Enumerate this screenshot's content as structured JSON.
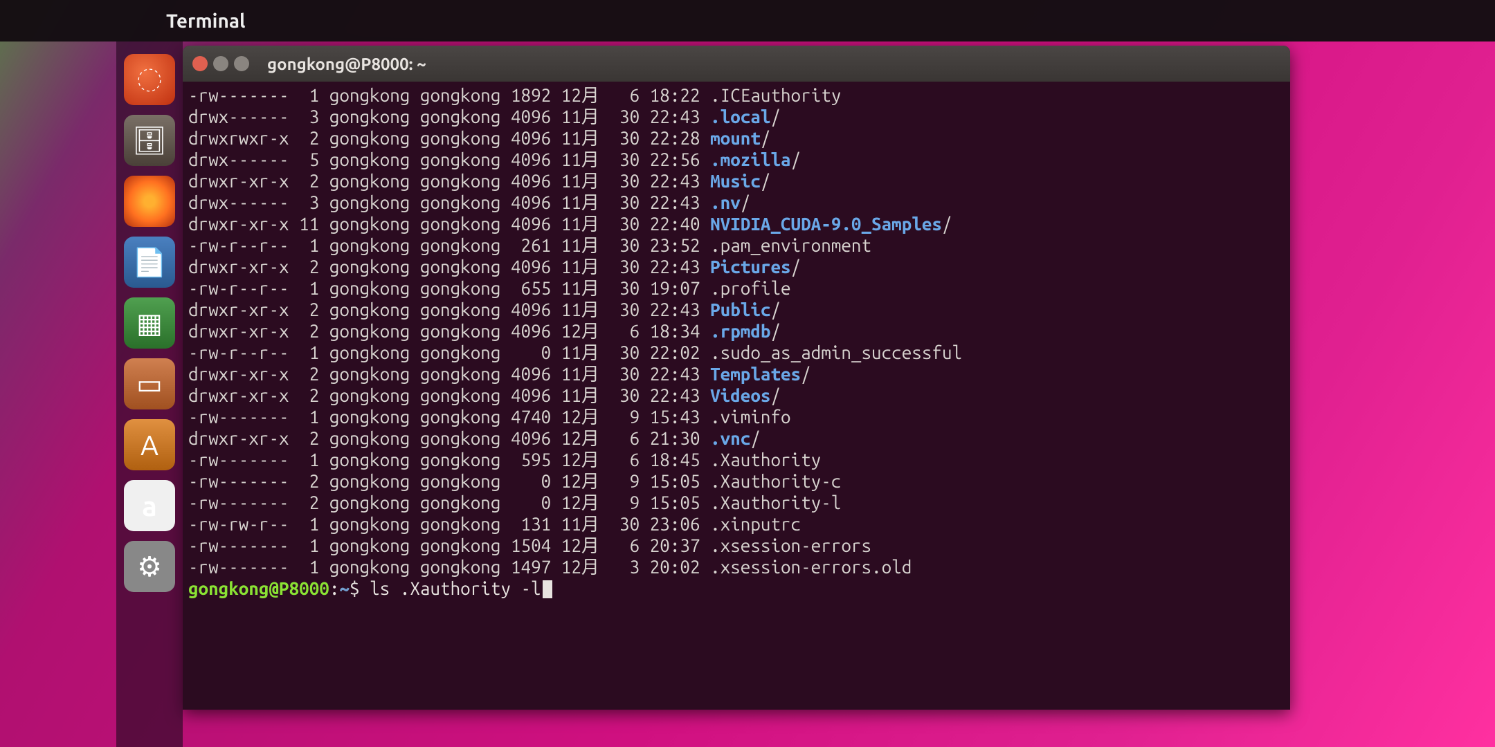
{
  "top_bar": {
    "title": "Terminal"
  },
  "dock": {
    "items": [
      {
        "name": "ubuntu",
        "glyph": "◌"
      },
      {
        "name": "files",
        "glyph": "🗄"
      },
      {
        "name": "firefox",
        "glyph": ""
      },
      {
        "name": "writer",
        "glyph": "📄"
      },
      {
        "name": "calc",
        "glyph": "▦"
      },
      {
        "name": "impress",
        "glyph": "▭"
      },
      {
        "name": "software",
        "glyph": "A"
      },
      {
        "name": "amazon",
        "glyph": "a"
      },
      {
        "name": "settings",
        "glyph": "⚙"
      }
    ]
  },
  "terminal": {
    "title": "gongkong@P8000: ~",
    "prompt": {
      "user_host": "gongkong@P8000",
      "path": "~",
      "command": "ls .Xauthority -l"
    },
    "listing": [
      {
        "perm": "-rw-------",
        "links": "1",
        "owner": "gongkong",
        "group": "gongkong",
        "size": "1892",
        "month": "12月",
        "day": "6",
        "time": "18:22",
        "name": ".ICEauthority",
        "is_dir": false
      },
      {
        "perm": "drwx------",
        "links": "3",
        "owner": "gongkong",
        "group": "gongkong",
        "size": "4096",
        "month": "11月",
        "day": "30",
        "time": "22:43",
        "name": ".local",
        "is_dir": true
      },
      {
        "perm": "drwxrwxr-x",
        "links": "2",
        "owner": "gongkong",
        "group": "gongkong",
        "size": "4096",
        "month": "11月",
        "day": "30",
        "time": "22:28",
        "name": "mount",
        "is_dir": true
      },
      {
        "perm": "drwx------",
        "links": "5",
        "owner": "gongkong",
        "group": "gongkong",
        "size": "4096",
        "month": "11月",
        "day": "30",
        "time": "22:56",
        "name": ".mozilla",
        "is_dir": true
      },
      {
        "perm": "drwxr-xr-x",
        "links": "2",
        "owner": "gongkong",
        "group": "gongkong",
        "size": "4096",
        "month": "11月",
        "day": "30",
        "time": "22:43",
        "name": "Music",
        "is_dir": true
      },
      {
        "perm": "drwx------",
        "links": "3",
        "owner": "gongkong",
        "group": "gongkong",
        "size": "4096",
        "month": "11月",
        "day": "30",
        "time": "22:43",
        "name": ".nv",
        "is_dir": true
      },
      {
        "perm": "drwxr-xr-x",
        "links": "11",
        "owner": "gongkong",
        "group": "gongkong",
        "size": "4096",
        "month": "11月",
        "day": "30",
        "time": "22:40",
        "name": "NVIDIA_CUDA-9.0_Samples",
        "is_dir": true
      },
      {
        "perm": "-rw-r--r--",
        "links": "1",
        "owner": "gongkong",
        "group": "gongkong",
        "size": "261",
        "month": "11月",
        "day": "30",
        "time": "23:52",
        "name": ".pam_environment",
        "is_dir": false
      },
      {
        "perm": "drwxr-xr-x",
        "links": "2",
        "owner": "gongkong",
        "group": "gongkong",
        "size": "4096",
        "month": "11月",
        "day": "30",
        "time": "22:43",
        "name": "Pictures",
        "is_dir": true
      },
      {
        "perm": "-rw-r--r--",
        "links": "1",
        "owner": "gongkong",
        "group": "gongkong",
        "size": "655",
        "month": "11月",
        "day": "30",
        "time": "19:07",
        "name": ".profile",
        "is_dir": false
      },
      {
        "perm": "drwxr-xr-x",
        "links": "2",
        "owner": "gongkong",
        "group": "gongkong",
        "size": "4096",
        "month": "11月",
        "day": "30",
        "time": "22:43",
        "name": "Public",
        "is_dir": true
      },
      {
        "perm": "drwxr-xr-x",
        "links": "2",
        "owner": "gongkong",
        "group": "gongkong",
        "size": "4096",
        "month": "12月",
        "day": "6",
        "time": "18:34",
        "name": ".rpmdb",
        "is_dir": true
      },
      {
        "perm": "-rw-r--r--",
        "links": "1",
        "owner": "gongkong",
        "group": "gongkong",
        "size": "0",
        "month": "11月",
        "day": "30",
        "time": "22:02",
        "name": ".sudo_as_admin_successful",
        "is_dir": false
      },
      {
        "perm": "drwxr-xr-x",
        "links": "2",
        "owner": "gongkong",
        "group": "gongkong",
        "size": "4096",
        "month": "11月",
        "day": "30",
        "time": "22:43",
        "name": "Templates",
        "is_dir": true
      },
      {
        "perm": "drwxr-xr-x",
        "links": "2",
        "owner": "gongkong",
        "group": "gongkong",
        "size": "4096",
        "month": "11月",
        "day": "30",
        "time": "22:43",
        "name": "Videos",
        "is_dir": true
      },
      {
        "perm": "-rw-------",
        "links": "1",
        "owner": "gongkong",
        "group": "gongkong",
        "size": "4740",
        "month": "12月",
        "day": "9",
        "time": "15:43",
        "name": ".viminfo",
        "is_dir": false
      },
      {
        "perm": "drwxr-xr-x",
        "links": "2",
        "owner": "gongkong",
        "group": "gongkong",
        "size": "4096",
        "month": "12月",
        "day": "6",
        "time": "21:30",
        "name": ".vnc",
        "is_dir": true
      },
      {
        "perm": "-rw-------",
        "links": "1",
        "owner": "gongkong",
        "group": "gongkong",
        "size": "595",
        "month": "12月",
        "day": "6",
        "time": "18:45",
        "name": ".Xauthority",
        "is_dir": false
      },
      {
        "perm": "-rw-------",
        "links": "2",
        "owner": "gongkong",
        "group": "gongkong",
        "size": "0",
        "month": "12月",
        "day": "9",
        "time": "15:05",
        "name": ".Xauthority-c",
        "is_dir": false
      },
      {
        "perm": "-rw-------",
        "links": "2",
        "owner": "gongkong",
        "group": "gongkong",
        "size": "0",
        "month": "12月",
        "day": "9",
        "time": "15:05",
        "name": ".Xauthority-l",
        "is_dir": false
      },
      {
        "perm": "-rw-rw-r--",
        "links": "1",
        "owner": "gongkong",
        "group": "gongkong",
        "size": "131",
        "month": "11月",
        "day": "30",
        "time": "23:06",
        "name": ".xinputrc",
        "is_dir": false
      },
      {
        "perm": "-rw-------",
        "links": "1",
        "owner": "gongkong",
        "group": "gongkong",
        "size": "1504",
        "month": "12月",
        "day": "6",
        "time": "20:37",
        "name": ".xsession-errors",
        "is_dir": false
      },
      {
        "perm": "-rw-------",
        "links": "1",
        "owner": "gongkong",
        "group": "gongkong",
        "size": "1497",
        "month": "12月",
        "day": "3",
        "time": "20:02",
        "name": ".xsession-errors.old",
        "is_dir": false
      }
    ]
  }
}
